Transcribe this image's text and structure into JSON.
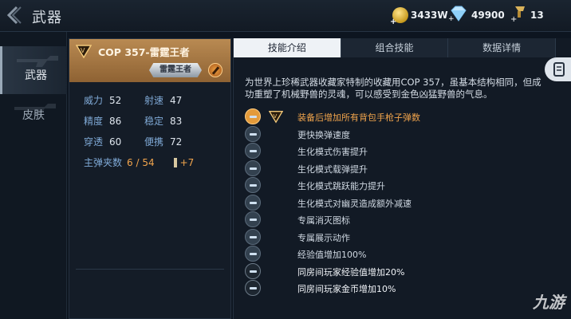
{
  "topbar": {
    "title": "武器"
  },
  "currencies": [
    {
      "icon": "gold-coin-icon",
      "value": "3433W"
    },
    {
      "icon": "diamond-icon",
      "value": "49900"
    },
    {
      "icon": "pass-icon",
      "value": "13"
    }
  ],
  "nav": [
    {
      "label": "武器",
      "active": true
    },
    {
      "label": "皮肤",
      "active": false
    }
  ],
  "weapon": {
    "name": "COP 357-雷霆王者",
    "title_badge": "雷霆王者",
    "stats": [
      {
        "key": "威力",
        "val": "52"
      },
      {
        "key": "射速",
        "val": "47"
      },
      {
        "key": "精度",
        "val": "86"
      },
      {
        "key": "稳定",
        "val": "83"
      },
      {
        "key": "穿透",
        "val": "60"
      },
      {
        "key": "便携",
        "val": "72"
      }
    ],
    "ammo_label": "主弹夹数",
    "ammo_value": "6 / 54",
    "ammo_bonus": "+7"
  },
  "tabs": [
    {
      "label": "技能介绍",
      "active": true
    },
    {
      "label": "组合技能",
      "active": false
    },
    {
      "label": "数据详情",
      "active": false
    }
  ],
  "description": "为世界上珍稀武器收藏家特制的收藏用COP 357，虽基本结构相同，但成功重塑了机械野兽的灵魂，可以感受到金色凶猛野兽的气息。",
  "skills": [
    {
      "text": "装备后增加所有背包手枪子弹数",
      "style": "hl",
      "icon": "gold"
    },
    {
      "text": "更快换弹速度",
      "style": "",
      "icon": ""
    },
    {
      "text": "生化模式伤害提升",
      "style": "",
      "icon": ""
    },
    {
      "text": "生化模式载弹提升",
      "style": "",
      "icon": ""
    },
    {
      "text": "生化模式跳跃能力提升",
      "style": "",
      "icon": ""
    },
    {
      "text": "生化模式对幽灵造成额外减速",
      "style": "",
      "icon": ""
    },
    {
      "text": "专属消灭图标",
      "style": "",
      "icon": ""
    },
    {
      "text": "专属展示动作",
      "style": "",
      "icon": ""
    },
    {
      "text": "经验值增加100%",
      "style": "",
      "icon": ""
    },
    {
      "text": "同房间玩家经验值增加20%",
      "style": "bright",
      "icon": "dark"
    },
    {
      "text": "同房间玩家金币增加10%",
      "style": "bright",
      "icon": "dark"
    }
  ],
  "watermark": "九游",
  "colors": {
    "accent_orange": "#f1a44c",
    "stat_label_blue": "#7fa9d6",
    "header_gold": "#b98a52"
  }
}
